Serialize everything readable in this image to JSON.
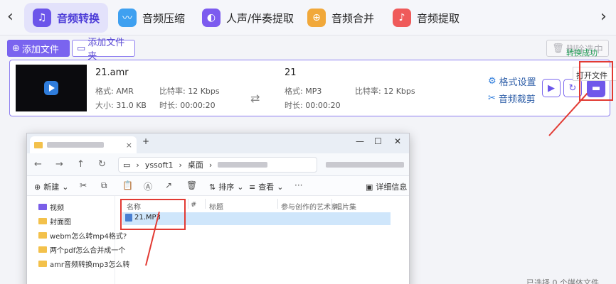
{
  "tabs": [
    {
      "label": "音频转换",
      "icon": "headphones-icon",
      "color": "#6c55ea",
      "active": true
    },
    {
      "label": "音频压缩",
      "icon": "waveform-icon",
      "color": "#3ea0f0",
      "active": false
    },
    {
      "label": "人声/伴奏提取",
      "icon": "wave-extract-icon",
      "color": "#7c5bef",
      "active": false
    },
    {
      "label": "音频合并",
      "icon": "merge-icon",
      "color": "#f1a83a",
      "active": false
    },
    {
      "label": "音频提取",
      "icon": "mic-icon",
      "color": "#ef5a5a",
      "active": false
    }
  ],
  "toolbar": {
    "add_file": "添加文件",
    "add_folder": "添加文件夹",
    "delete_selected": "删除选中"
  },
  "file": {
    "source_name": "21.amr",
    "source_format_label": "格式:",
    "source_format": "AMR",
    "source_bitrate_label": "比特率:",
    "source_bitrate": "12 Kbps",
    "source_size_label": "大小:",
    "source_size": "31.0 KB",
    "source_duration_label": "时长:",
    "source_duration": "00:00:20",
    "target_name": "21",
    "target_format_label": "格式:",
    "target_format": "MP3",
    "target_bitrate_label": "比特率:",
    "target_bitrate": "12 Kbps",
    "target_duration_label": "时长:",
    "target_duration": "00:00:20",
    "format_settings": "格式设置",
    "audio_trim": "音频裁剪",
    "status": "转换成功",
    "tooltip": "打开文件"
  },
  "explorer": {
    "new_tab": "+",
    "address_segments": [
      "yssoft1",
      "桌面"
    ],
    "commands": {
      "new": "新建",
      "sort": "排序",
      "view": "查看",
      "details": "详细信息"
    },
    "sidebar": [
      "视频",
      "封面图",
      "webm怎么转mp4格式?",
      "两个pdf怎么合并成一个",
      "amr音频转换mp3怎么转"
    ],
    "columns": [
      "名称",
      "#",
      "标题",
      "参与创作的艺术家",
      "唱片集"
    ],
    "files": [
      "21.MP3"
    ]
  },
  "status_bar": "已选择 0 个媒体文件"
}
